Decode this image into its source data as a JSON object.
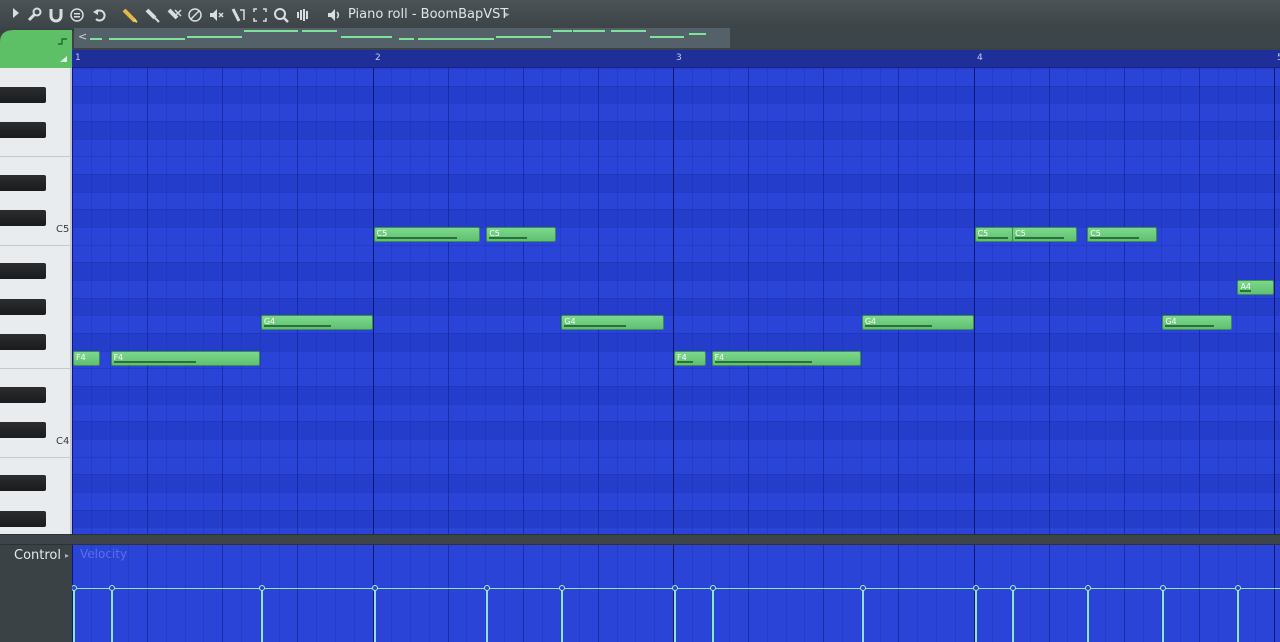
{
  "window": {
    "title": "Piano roll - BoomBapVST",
    "title_arrow": "▸"
  },
  "toolbar": {
    "icons": [
      "play-arrow-icon",
      "wrench-icon",
      "magnet-icon",
      "record-icon",
      "undo-icon",
      "pencil-icon",
      "paint-brush-icon",
      "delete-icon",
      "mute-icon",
      "slice-icon",
      "select-icon",
      "zoom-icon",
      "playback-icon",
      "speaker-icon"
    ]
  },
  "overview": {
    "left_arrow": "<"
  },
  "ruler": {
    "bars": [
      "1",
      "2",
      "3",
      "4",
      "5"
    ]
  },
  "keyboard": {
    "labels": [
      "C5",
      "C4"
    ]
  },
  "notes": [
    {
      "label": "F4"
    },
    {
      "label": "F4"
    },
    {
      "label": "G4"
    },
    {
      "label": "C5"
    },
    {
      "label": "C5"
    },
    {
      "label": "G4"
    },
    {
      "label": "F4"
    },
    {
      "label": "F4"
    },
    {
      "label": "G4"
    },
    {
      "label": "C5"
    },
    {
      "label": "C5"
    },
    {
      "label": "C5"
    },
    {
      "label": "G4"
    },
    {
      "label": "A4"
    }
  ],
  "control": {
    "label": "Control",
    "arrow": "▸",
    "parameter": "Velocity"
  },
  "colors": {
    "grid": "#2a44d8",
    "note": "#6fcf80",
    "velocity": "#8ee7c4",
    "ruler": "#1f2f9a"
  }
}
